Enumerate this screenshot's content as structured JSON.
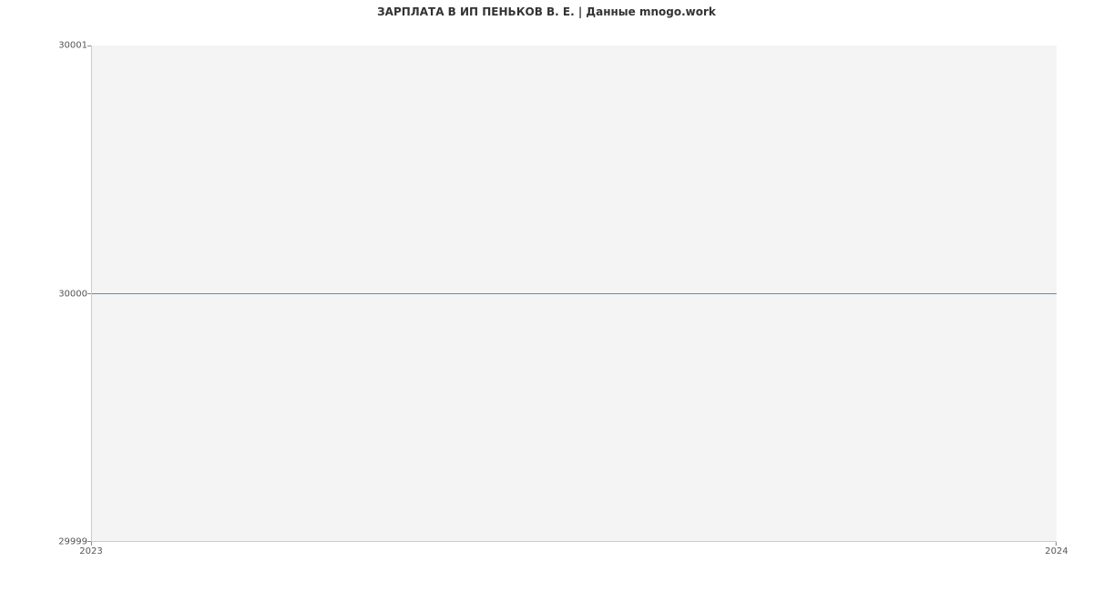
{
  "chart_data": {
    "type": "line",
    "title": "ЗАРПЛАТА В ИП ПЕНЬКОВ В. Е. | Данные mnogo.work",
    "x": [
      "2023",
      "2024"
    ],
    "values": [
      30000,
      30000
    ],
    "xlabel": "",
    "ylabel": "",
    "ylim": [
      29999,
      30001
    ],
    "y_ticks": [
      29999,
      30000,
      30001
    ],
    "x_ticks": [
      "2023",
      "2024"
    ],
    "line_color": "#4c8ee2"
  }
}
